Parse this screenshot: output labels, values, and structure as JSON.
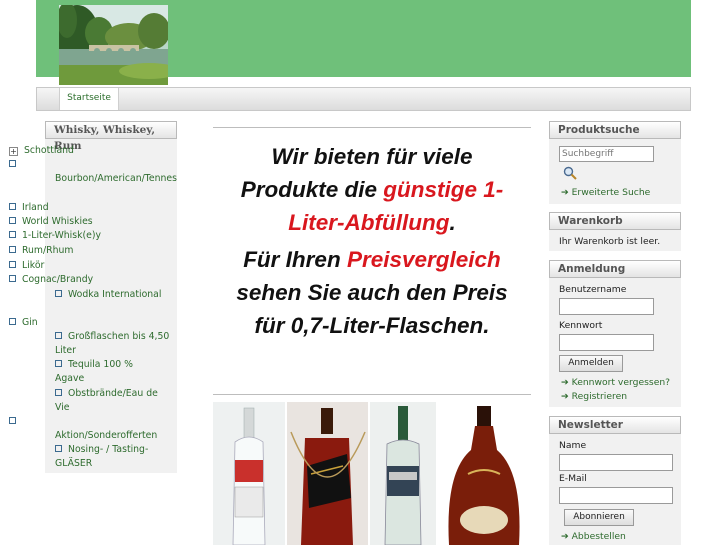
{
  "nav": {
    "home": "Startseite"
  },
  "categories": {
    "title": "Whisky, Whiskey, Rum",
    "items": [
      {
        "label": "Schottland",
        "expanded": true
      },
      {
        "label": "Bourbon/American/Tennessee Whisk(e)y"
      },
      {
        "label": "Irland"
      },
      {
        "label": "World Whiskies"
      },
      {
        "label": "1-Liter-Whisk(e)y"
      },
      {
        "label": "Rum/Rhum"
      },
      {
        "label": "Likör"
      },
      {
        "label": "Cognac/Brandy"
      },
      {
        "label": "Wodka International"
      },
      {
        "label": "Gin"
      },
      {
        "label": "Großflaschen bis 4,50 Liter"
      },
      {
        "label": "Tequila 100 % Agave"
      },
      {
        "label": "Obstbrände/Eau de Vie"
      },
      {
        "label": "Aktion/Sonderofferten"
      },
      {
        "label": "Nosing- / Tasting-GLÄSER"
      }
    ]
  },
  "promo": {
    "line1": "Wir bieten für viele",
    "line2_a": "Produkte die ",
    "line2_b": "günstige 1-",
    "line3_a": "Liter-Abfüllung",
    "line3_b": ".",
    "line4_a": "Für Ihren ",
    "line4_b": "Preisvergleich",
    "line5": "sehen Sie auch den Preis",
    "line6": "für 0,7-Liter-Flaschen."
  },
  "search": {
    "title": "Produktsuche",
    "placeholder": "Suchbegriff",
    "advanced": "Erweiterte Suche"
  },
  "cart": {
    "title": "Warenkorb",
    "status": "Ihr Warenkorb ist leer."
  },
  "login": {
    "title": "Anmeldung",
    "user_label": "Benutzername",
    "pass_label": "Kennwort",
    "button": "Anmelden",
    "forgot": "Kennwort vergessen?",
    "register": "Registrieren"
  },
  "newsletter": {
    "title": "Newsletter",
    "name_label": "Name",
    "email_label": "E-Mail",
    "button": "Abonnieren",
    "unsubscribe": "Abbestellen"
  },
  "colors": {
    "header": "#6fc07a",
    "link": "#2e6b2e",
    "accent_red": "#d9171e"
  }
}
